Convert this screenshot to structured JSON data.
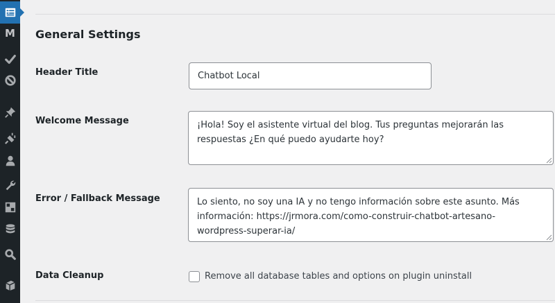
{
  "sidebar": {
    "items": [
      {
        "icon": "settings-form-icon",
        "active": true
      },
      {
        "icon": "m-logo-icon",
        "glyph": "M"
      },
      {
        "icon": "checkmark-icon"
      },
      {
        "icon": "blocked-circle-icon"
      },
      {
        "icon": "pin-icon"
      },
      {
        "icon": "plugins-icon"
      },
      {
        "icon": "users-icon"
      },
      {
        "icon": "tools-wrench-icon"
      },
      {
        "icon": "grid-icon"
      },
      {
        "icon": "database-icon"
      },
      {
        "icon": "search-icon"
      },
      {
        "icon": "box-icon"
      }
    ],
    "colors": {
      "background": "#1d2327",
      "active": "#2271b1",
      "icon": "#a7aaad"
    }
  },
  "section": {
    "title": "General Settings"
  },
  "fields": {
    "header_title": {
      "label": "Header Title",
      "value": "Chatbot Local"
    },
    "welcome_message": {
      "label": "Welcome Message",
      "value": "¡Hola! Soy el asistente virtual del blog. Tus preguntas mejorarán las respuestas ¿En qué puedo ayudarte hoy?"
    },
    "error_message": {
      "label": "Error / Fallback Message",
      "value": "Lo siento, no soy una IA y no tengo información sobre este asunto. Más información: https://jrmora.com/como-construir-chatbot-artesano-wordpress-superar-ia/"
    },
    "data_cleanup": {
      "label": "Data Cleanup",
      "checkbox_label": "Remove all database tables and options on plugin uninstall",
      "checked": false
    }
  }
}
